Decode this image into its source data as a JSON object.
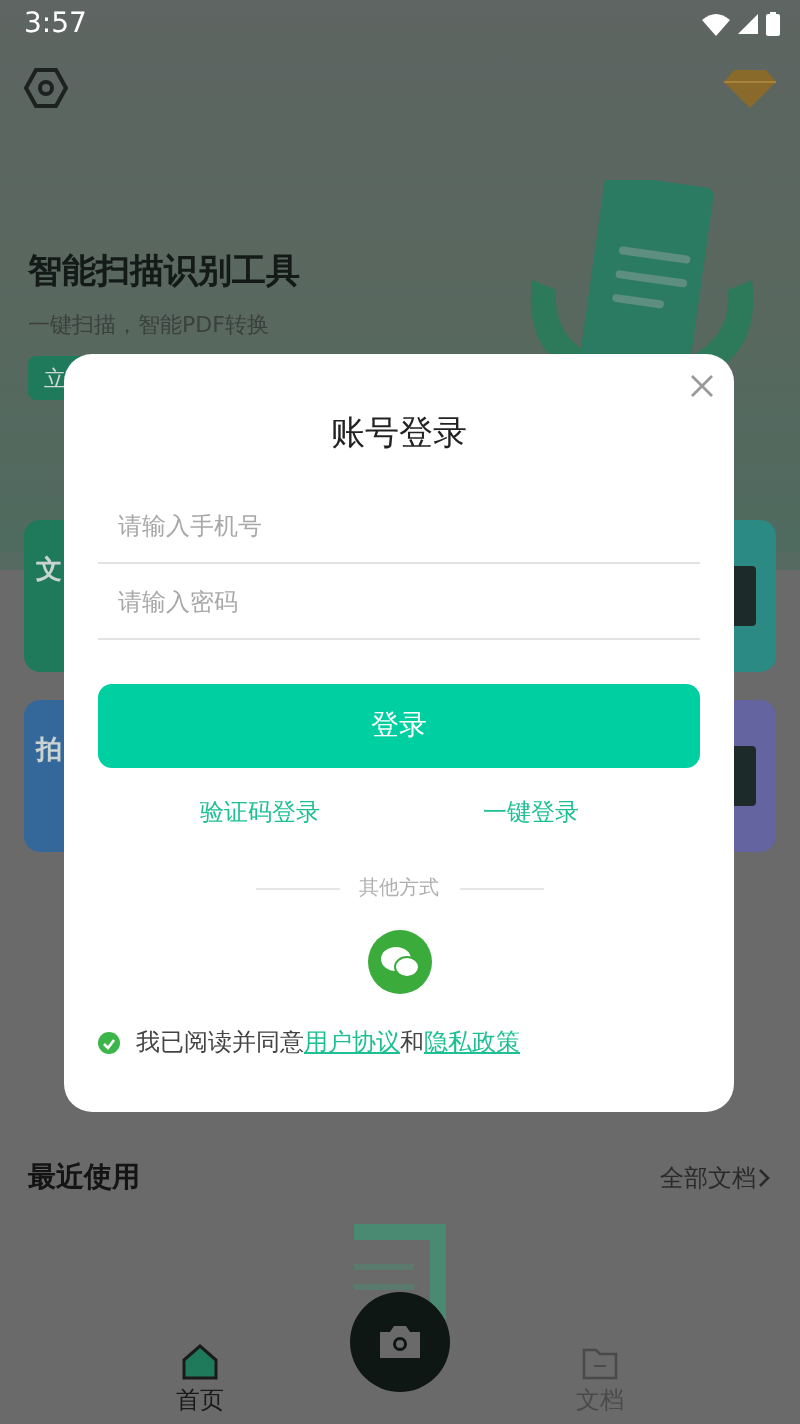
{
  "status_bar": {
    "time": "3:57"
  },
  "hero": {
    "title": "智能扫描识别工具",
    "subtitle": "一键扫描，智能PDF转换",
    "button": "立"
  },
  "feature_cards": [
    {
      "title": "文",
      "color": "#1f7a5c"
    },
    {
      "title": "拍",
      "color": "#35689a"
    }
  ],
  "recent": {
    "title": "最近使用",
    "link": "全部文档"
  },
  "bottom_nav": [
    {
      "label": "首页",
      "kind": "home",
      "selected": true
    },
    {
      "label": "文档",
      "kind": "folder",
      "selected": false
    }
  ],
  "login_dialog": {
    "title": "账号登录",
    "phone_placeholder": "请输入手机号",
    "password_placeholder": "请输入密码",
    "submit": "登录",
    "alt_links": [
      "验证码登录",
      "一键登录"
    ],
    "divider": "其他方式",
    "agreement": {
      "checked": true,
      "prefix": "我已阅读并同意",
      "link_1": "用户协议",
      "joiner": "和",
      "link_2": "隐私政策"
    }
  }
}
